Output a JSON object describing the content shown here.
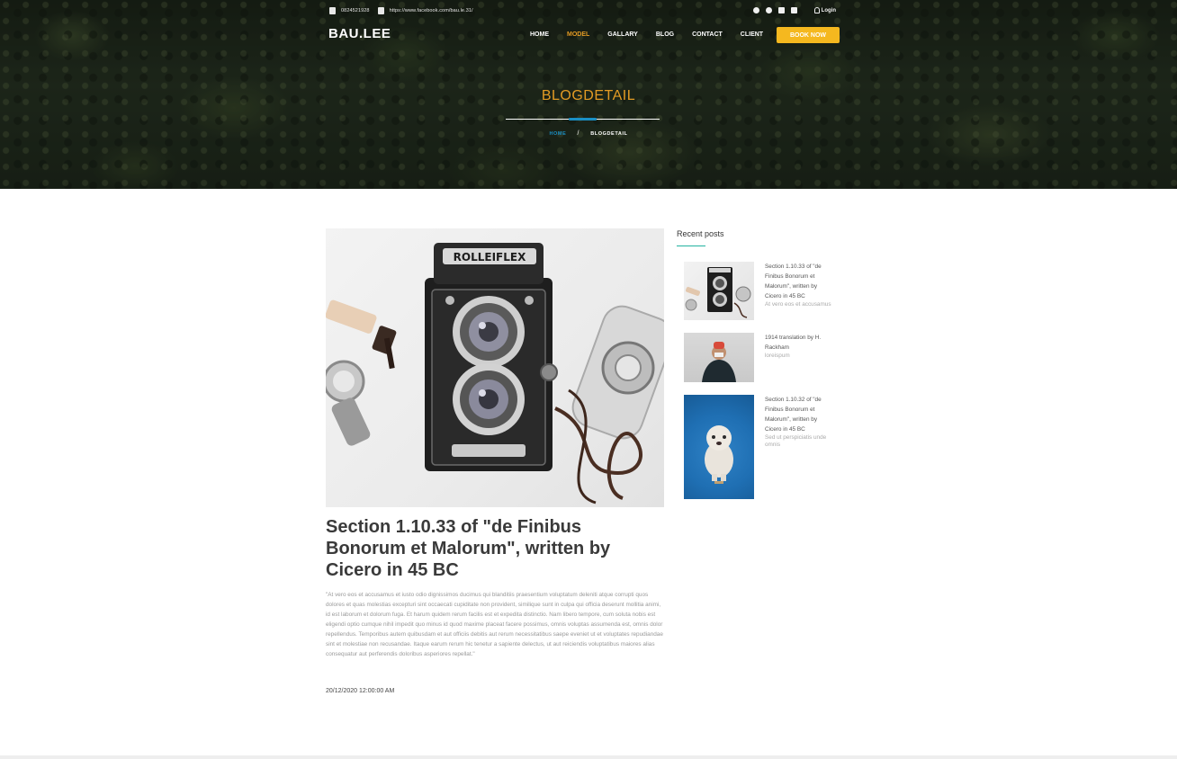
{
  "topbar": {
    "phone": "0824521928",
    "facebook_url": "https://www.facebook.com/bau.le.31/",
    "social_icons": [
      "facebook-icon",
      "dribbble-icon",
      "linkedin-icon",
      "youtube-icon"
    ],
    "login_label": "Login"
  },
  "header": {
    "logo": "BAU.LEE",
    "nav": [
      "HOME",
      "MODEL",
      "GALLARY",
      "BLOG",
      "CONTACT",
      "CLIENT"
    ],
    "active_nav": "MODEL",
    "book_label": "BOOK NOW"
  },
  "hero": {
    "title": "BLOGDETAIL",
    "breadcrumb_home": "HOME",
    "breadcrumb_sep": "/",
    "breadcrumb_current": "BLOGDETAIL"
  },
  "post": {
    "title": "Section 1.10.33 of \"de Finibus Bonorum et Malorum\", written by Cicero in 45 BC",
    "body": "\"At vero eos et accusamus et iusto odio dignissimos ducimus qui blanditiis praesentium voluptatum deleniti atque corrupti quos dolores et quas molestias excepturi sint occaecati cupiditate non provident, similique sunt in culpa qui officia deserunt mollitia animi, id est laborum et dolorum fuga. Et harum quidem rerum facilis est et expedita distinctio. Nam libero tempore, cum soluta nobis est eligendi optio cumque nihil impedit quo minus id quod maxime placeat facere possimus, omnis voluptas assumenda est, omnis dolor repellendus. Temporibus autem quibusdam et aut officiis debitis aut rerum necessitatibus saepe eveniet ut et voluptates repudiandae sint et molestiae non recusandae. Itaque earum rerum hic tenetur a sapiente delectus, ut aut reiciendis voluptatibus maiores alias consequatur aut perferendis doloribus asperiores repellat.\"",
    "date": "20/12/2020 12:00:00 AM",
    "camera_brand": "ROLLEIFLEX"
  },
  "sidebar": {
    "title": "Recent posts",
    "posts": [
      {
        "title": "Section 1.10.33 of \"de Finibus Bonorum et Malorum\", written by Cicero in 45 BC",
        "desc": "At vero eos et accusamus"
      },
      {
        "title": "1914 translation by H. Rackham",
        "desc": "loreispum"
      },
      {
        "title": "Section 1.10.32 of \"de Finibus Bonorum et Malorum\", written by Cicero in 45 BC",
        "desc": "Sed ut perspiciatis unde omnis"
      }
    ]
  },
  "colors": {
    "accent_orange": "#e39b24",
    "book_button": "#f5b81f",
    "link_blue": "#1a8fc4",
    "sidebar_line": "#23b3a0"
  }
}
